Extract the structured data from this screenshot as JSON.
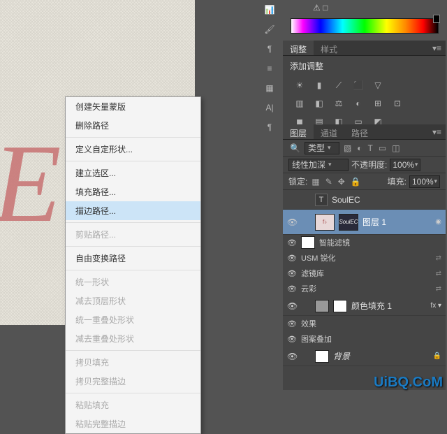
{
  "contextMenu": {
    "items": [
      {
        "label": "创建矢量蒙版",
        "disabled": false
      },
      {
        "label": "删除路径",
        "disabled": false
      },
      {
        "sep": true
      },
      {
        "label": "定义自定形状...",
        "disabled": false
      },
      {
        "sep": true
      },
      {
        "label": "建立选区...",
        "disabled": false
      },
      {
        "label": "填充路径...",
        "disabled": false
      },
      {
        "label": "描边路径...",
        "disabled": false,
        "hover": true
      },
      {
        "sep": true
      },
      {
        "label": "剪贴路径...",
        "disabled": true
      },
      {
        "sep": true
      },
      {
        "label": "自由变换路径",
        "disabled": false
      },
      {
        "sep": true
      },
      {
        "label": "统一形状",
        "disabled": true
      },
      {
        "label": "减去顶层形状",
        "disabled": true
      },
      {
        "label": "统一重叠处形状",
        "disabled": true
      },
      {
        "label": "减去重叠处形状",
        "disabled": true
      },
      {
        "sep": true
      },
      {
        "label": "拷贝填充",
        "disabled": true
      },
      {
        "label": "拷贝完整描边",
        "disabled": true
      },
      {
        "sep": true
      },
      {
        "label": "粘贴填充",
        "disabled": true
      },
      {
        "label": "粘贴完整描边",
        "disabled": true
      }
    ]
  },
  "adjustPanel": {
    "tabs": [
      "调整",
      "样式"
    ],
    "title": "添加调整"
  },
  "layersPanel": {
    "tabs": [
      "图层",
      "通道",
      "路径"
    ],
    "kindLabel": "类型",
    "blendMode": "线性加深",
    "opacityLabel": "不透明度:",
    "opacityValue": "100%",
    "lockLabel": "锁定:",
    "fillLabel": "填充:",
    "fillValue": "100%",
    "layers": {
      "text": "SoulEC",
      "group1": "图层 1",
      "smartFilters": "智能滤镜",
      "usm": "USM 锐化",
      "filterGallery": "滤镜库",
      "clouds": "云彩",
      "colorFill": "颜色填充 1",
      "effects": "效果",
      "patternOverlay": "图案叠加",
      "background": "背景"
    },
    "thumbText": "SoulEC"
  },
  "watermark": "UiBQ.CoM"
}
